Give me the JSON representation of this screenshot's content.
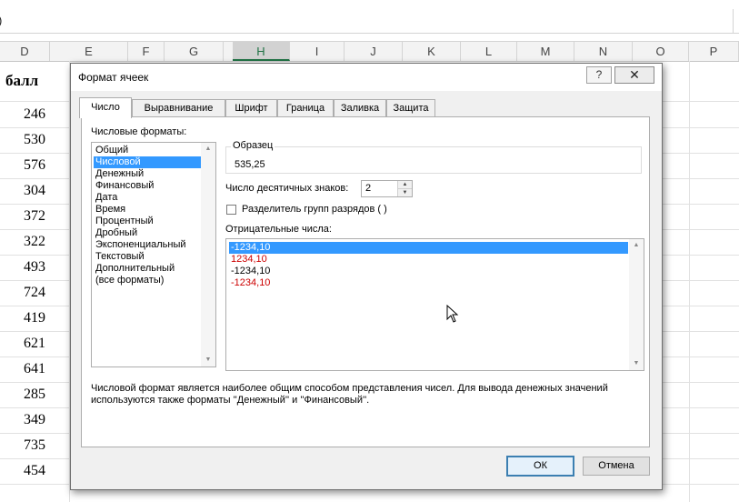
{
  "spreadsheet": {
    "formula_text": ")",
    "columns": [
      "D",
      "E",
      "F",
      "G",
      "H",
      "I",
      "J",
      "K",
      "L",
      "M",
      "N",
      "O",
      "P"
    ],
    "selected_column": "H",
    "header_cell": "балл",
    "values": [
      "246",
      "530",
      "576",
      "304",
      "372",
      "322",
      "493",
      "724",
      "419",
      "621",
      "641",
      "285",
      "349",
      "735",
      "454"
    ]
  },
  "dialog": {
    "title": "Формат ячеек",
    "help_label": "?",
    "close_label": "✕",
    "tabs": [
      "Число",
      "Выравнивание",
      "Шрифт",
      "Граница",
      "Заливка",
      "Защита"
    ],
    "active_tab": "Число",
    "formats_label": "Числовые форматы:",
    "formats": [
      "Общий",
      "Числовой",
      "Денежный",
      "Финансовый",
      "Дата",
      "Время",
      "Процентный",
      "Дробный",
      "Экспоненциальный",
      "Текстовый",
      "Дополнительный",
      "(все форматы)"
    ],
    "selected_format": "Числовой",
    "sample_label": "Образец",
    "sample_value": "535,25",
    "decimals_label": "Число десятичных знаков:",
    "decimals_value": "2",
    "separator_label": "Разделитель групп разрядов ( )",
    "separator_checked": false,
    "negative_label": "Отрицательные числа:",
    "negative_options": [
      {
        "text": "-1234,10",
        "color": "#000000",
        "selected": true
      },
      {
        "text": "1234,10",
        "color": "#cc0000",
        "selected": false
      },
      {
        "text": "-1234,10",
        "color": "#000000",
        "selected": false
      },
      {
        "text": "-1234,10",
        "color": "#cc0000",
        "selected": false
      }
    ],
    "description": "Числовой формат является наиболее общим способом представления чисел. Для вывода денежных значений используются также форматы ''Денежный'' и ''Финансовый''.",
    "ok_label": "ОК",
    "cancel_label": "Отмена",
    "selection_color": "#3399ff"
  }
}
